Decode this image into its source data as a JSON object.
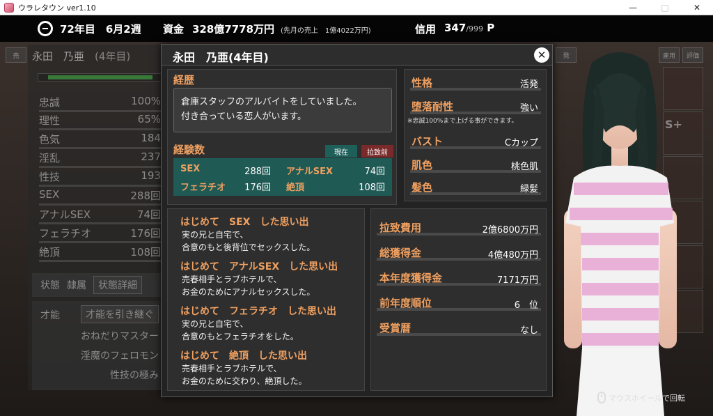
{
  "window": {
    "title": "ウラレタウン ver1.10"
  },
  "hud": {
    "date": "72年目　6月2週",
    "funds_label": "資金",
    "funds": "328億7778万円",
    "sales": "(先月の売上　1億4022万円)",
    "credit_label": "信用",
    "credit": "347",
    "credit_max": "/999",
    "credit_unit": "P"
  },
  "background": {
    "name": "永田　乃亜",
    "grade": "(4年目)",
    "stats": [
      {
        "label": "忠誠",
        "value": "100%"
      },
      {
        "label": "理性",
        "value": "65%"
      },
      {
        "label": "色気",
        "value": "184"
      },
      {
        "label": "淫乱",
        "value": "237"
      },
      {
        "label": "性技",
        "value": "193"
      },
      {
        "label": "SEX",
        "value": "288回"
      },
      {
        "label": "アナルSEX",
        "value": "74回"
      },
      {
        "label": "フェラチオ",
        "value": "176回"
      },
      {
        "label": "絶頂",
        "value": "108回"
      }
    ],
    "state_label": "状態",
    "state_value": "隷属",
    "state_detail_btn": "状態詳細",
    "talent_label": "才能",
    "talent_inherit_btn": "才能を引き継ぐ",
    "talents": [
      "おねだりマスター",
      "淫魔のフェロモン",
      "性技の極み"
    ],
    "tab_labels": [
      "売",
      "雇用",
      "評価",
      "発"
    ],
    "rank_badge": "S+"
  },
  "modal": {
    "title": "永田　乃亜(4年目)",
    "history_label": "経歴",
    "history_lines": [
      "倉庫スタッフのアルバイトをしていました。",
      "付き合っている恋人がいます。"
    ],
    "exp_label": "経験数",
    "tab_current": "現在",
    "tab_before": "拉致前",
    "experience": [
      {
        "key": "SEX",
        "value": "288回"
      },
      {
        "key": "アナルSEX",
        "value": "74回"
      },
      {
        "key": "フェラチオ",
        "value": "176回"
      },
      {
        "key": "絶頂",
        "value": "108回"
      }
    ],
    "traits": [
      {
        "key": "性格",
        "value": "活発"
      },
      {
        "key": "堕落耐性",
        "value": "強い"
      },
      {
        "key": "バスト",
        "value": "Cカップ"
      },
      {
        "key": "肌色",
        "value": "桃色肌"
      },
      {
        "key": "髪色",
        "value": "緑髪"
      }
    ],
    "trait_note": "※忠誠100%まで上げる事ができます。",
    "memories": [
      {
        "title": "はじめて　SEX　した思い出",
        "lines": [
          "実の兄と自宅で、",
          "合意のもと後背位でセックスした。"
        ]
      },
      {
        "title": "はじめて　アナルSEX　した思い出",
        "lines": [
          "売春相手とラブホテルで、",
          "お金のためにアナルセックスした。"
        ]
      },
      {
        "title": "はじめて　フェラチオ　した思い出",
        "lines": [
          "実の兄と自宅で、",
          "合意のもとフェラチオをした。"
        ]
      },
      {
        "title": "はじめて　絶頂　した思い出",
        "lines": [
          "売春相手とラブホテルで、",
          "お金のために交わり、絶頂した。"
        ]
      }
    ],
    "money": [
      {
        "key": "拉致費用",
        "value": "2億6800万円"
      },
      {
        "key": "総獲得金",
        "value": "4億480万円"
      },
      {
        "key": "本年度獲得金",
        "value": "7171万円"
      },
      {
        "key": "前年度順位",
        "value": "6　位"
      },
      {
        "key": "受賞暦",
        "value": "なし"
      }
    ]
  },
  "hint": "マウスホイールで回転"
}
